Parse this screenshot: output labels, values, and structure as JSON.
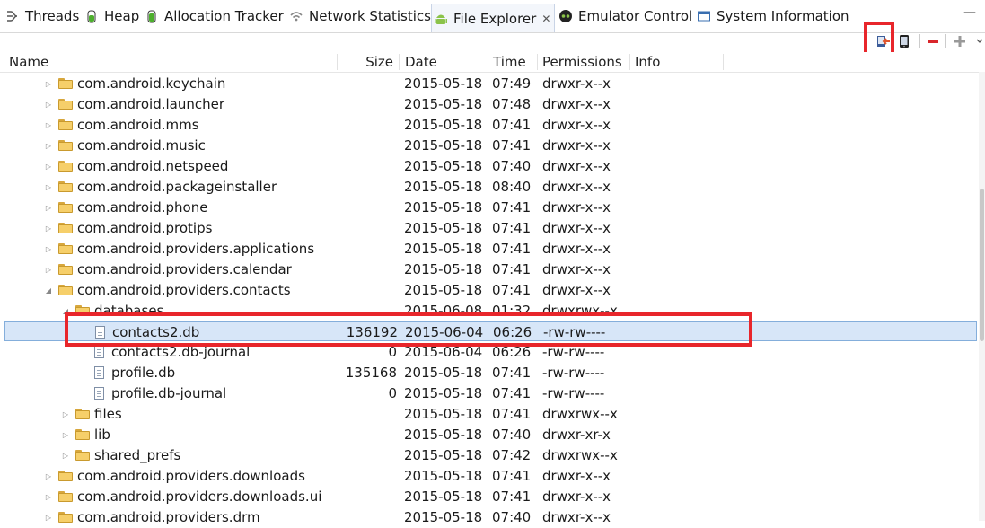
{
  "tabs": [
    {
      "label": "Threads",
      "icon": "threads-icon"
    },
    {
      "label": "Heap",
      "icon": "heap-icon"
    },
    {
      "label": "Allocation Tracker",
      "icon": "allocation-tracker-icon"
    },
    {
      "label": "Network Statistics",
      "icon": "wifi-icon"
    },
    {
      "label": "File Explorer",
      "icon": "android-icon",
      "active": true,
      "close": "✕"
    },
    {
      "label": "Emulator Control",
      "icon": "emulator-icon"
    },
    {
      "label": "System Information",
      "icon": "system-info-icon"
    }
  ],
  "window": {
    "minimize": "—"
  },
  "toolbar": {
    "pull_icon": "pull-file-from-device-icon",
    "push_icon": "push-file-onto-device-icon",
    "delete_label": "—",
    "new_folder_label": "+",
    "menu_label": "▾"
  },
  "columns": {
    "name": "Name",
    "size": "Size",
    "date": "Date",
    "time": "Time",
    "permissions": "Permissions",
    "info": "Info"
  },
  "rows": [
    {
      "name": "com.android.keychain",
      "size": "",
      "date": "2015-05-18",
      "time": "07:49",
      "perm": "drwxr-x--x",
      "type": "folder",
      "depth": 0,
      "expand": "collapsed"
    },
    {
      "name": "com.android.launcher",
      "size": "",
      "date": "2015-05-18",
      "time": "07:48",
      "perm": "drwxr-x--x",
      "type": "folder",
      "depth": 0,
      "expand": "collapsed"
    },
    {
      "name": "com.android.mms",
      "size": "",
      "date": "2015-05-18",
      "time": "07:41",
      "perm": "drwxr-x--x",
      "type": "folder",
      "depth": 0,
      "expand": "collapsed"
    },
    {
      "name": "com.android.music",
      "size": "",
      "date": "2015-05-18",
      "time": "07:41",
      "perm": "drwxr-x--x",
      "type": "folder",
      "depth": 0,
      "expand": "collapsed"
    },
    {
      "name": "com.android.netspeed",
      "size": "",
      "date": "2015-05-18",
      "time": "07:40",
      "perm": "drwxr-x--x",
      "type": "folder",
      "depth": 0,
      "expand": "collapsed"
    },
    {
      "name": "com.android.packageinstaller",
      "size": "",
      "date": "2015-05-18",
      "time": "08:40",
      "perm": "drwxr-x--x",
      "type": "folder",
      "depth": 0,
      "expand": "collapsed"
    },
    {
      "name": "com.android.phone",
      "size": "",
      "date": "2015-05-18",
      "time": "07:41",
      "perm": "drwxr-x--x",
      "type": "folder",
      "depth": 0,
      "expand": "collapsed"
    },
    {
      "name": "com.android.protips",
      "size": "",
      "date": "2015-05-18",
      "time": "07:41",
      "perm": "drwxr-x--x",
      "type": "folder",
      "depth": 0,
      "expand": "collapsed"
    },
    {
      "name": "com.android.providers.applications",
      "size": "",
      "date": "2015-05-18",
      "time": "07:41",
      "perm": "drwxr-x--x",
      "type": "folder",
      "depth": 0,
      "expand": "collapsed"
    },
    {
      "name": "com.android.providers.calendar",
      "size": "",
      "date": "2015-05-18",
      "time": "07:41",
      "perm": "drwxr-x--x",
      "type": "folder",
      "depth": 0,
      "expand": "collapsed"
    },
    {
      "name": "com.android.providers.contacts",
      "size": "",
      "date": "2015-05-18",
      "time": "07:41",
      "perm": "drwxr-x--x",
      "type": "folder",
      "depth": 0,
      "expand": "expanded"
    },
    {
      "name": "databases",
      "size": "",
      "date": "2015-06-08",
      "time": "01:32",
      "perm": "drwxrwx--x",
      "type": "folder",
      "depth": 1,
      "expand": "expanded"
    },
    {
      "name": "contacts2.db",
      "size": "136192",
      "date": "2015-06-04",
      "time": "06:26",
      "perm": "-rw-rw----",
      "type": "file",
      "depth": 2,
      "expand": "none",
      "selected": true
    },
    {
      "name": "contacts2.db-journal",
      "size": "0",
      "date": "2015-06-04",
      "time": "06:26",
      "perm": "-rw-rw----",
      "type": "file",
      "depth": 2,
      "expand": "none"
    },
    {
      "name": "profile.db",
      "size": "135168",
      "date": "2015-05-18",
      "time": "07:41",
      "perm": "-rw-rw----",
      "type": "file",
      "depth": 2,
      "expand": "none"
    },
    {
      "name": "profile.db-journal",
      "size": "0",
      "date": "2015-05-18",
      "time": "07:41",
      "perm": "-rw-rw----",
      "type": "file",
      "depth": 2,
      "expand": "none"
    },
    {
      "name": "files",
      "size": "",
      "date": "2015-05-18",
      "time": "07:41",
      "perm": "drwxrwx--x",
      "type": "folder",
      "depth": 1,
      "expand": "collapsed"
    },
    {
      "name": "lib",
      "size": "",
      "date": "2015-05-18",
      "time": "07:40",
      "perm": "drwxr-xr-x",
      "type": "folder",
      "depth": 1,
      "expand": "collapsed"
    },
    {
      "name": "shared_prefs",
      "size": "",
      "date": "2015-05-18",
      "time": "07:42",
      "perm": "drwxrwx--x",
      "type": "folder",
      "depth": 1,
      "expand": "collapsed"
    },
    {
      "name": "com.android.providers.downloads",
      "size": "",
      "date": "2015-05-18",
      "time": "07:41",
      "perm": "drwxr-x--x",
      "type": "folder",
      "depth": 0,
      "expand": "collapsed"
    },
    {
      "name": "com.android.providers.downloads.ui",
      "size": "",
      "date": "2015-05-18",
      "time": "07:41",
      "perm": "drwxr-x--x",
      "type": "folder",
      "depth": 0,
      "expand": "collapsed"
    },
    {
      "name": "com.android.providers.drm",
      "size": "",
      "date": "2015-05-18",
      "time": "07:40",
      "perm": "drwxr-x--x",
      "type": "folder",
      "depth": 0,
      "expand": "collapsed"
    }
  ],
  "colors": {
    "highlight": "#e8262b",
    "selection": "#d7e6f8",
    "folder": "#f6cf6a"
  }
}
